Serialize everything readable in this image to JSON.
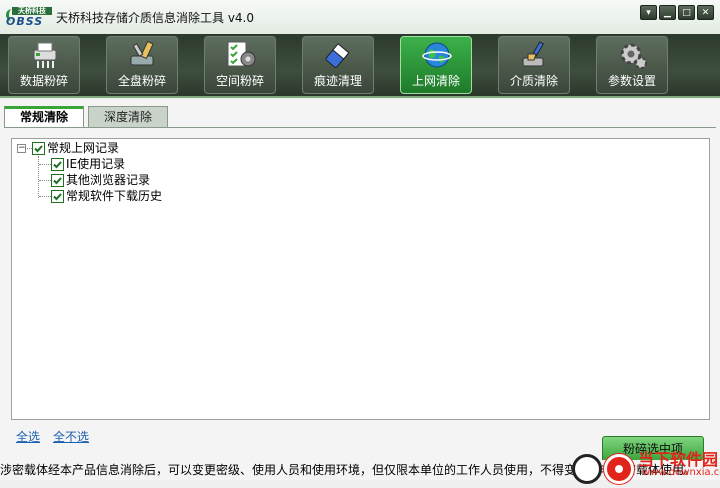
{
  "window": {
    "title": "天桥科技存储介质信息消除工具 v4.0",
    "logo_top": "天桥科技",
    "logo_bottom": "OBSS"
  },
  "toolbar": {
    "items": [
      {
        "label": "数据粉碎",
        "icon": "shredder-icon",
        "active": false
      },
      {
        "label": "全盘粉碎",
        "icon": "disk-shred-icon",
        "active": false
      },
      {
        "label": "空间粉碎",
        "icon": "space-shred-icon",
        "active": false
      },
      {
        "label": "痕迹清理",
        "icon": "eraser-icon",
        "active": false
      },
      {
        "label": "上网清除",
        "icon": "globe-icon",
        "active": true
      },
      {
        "label": "介质清除",
        "icon": "brush-icon",
        "active": false
      },
      {
        "label": "参数设置",
        "icon": "gear-icon",
        "active": false
      }
    ]
  },
  "tabs": [
    {
      "label": "常规清除",
      "active": true
    },
    {
      "label": "深度清除",
      "active": false
    }
  ],
  "tree": {
    "root": {
      "label": "常规上网记录",
      "checked": true,
      "expanded": true
    },
    "children": [
      {
        "label": "IE使用记录",
        "checked": true
      },
      {
        "label": "其他浏览器记录",
        "checked": true
      },
      {
        "label": "常规软件下载历史",
        "checked": true
      }
    ]
  },
  "actions": {
    "select_all": "全选",
    "select_none": "全不选",
    "shred_selected": "粉碎选中项"
  },
  "status_text": "涉密载体经本产品信息消除后，可以变更密级、使用人员和使用环境，但仅限本单位的工作人员使用，不得变更为非涉密载体使用。",
  "watermark": {
    "brand": "当下软件园",
    "url": "www.downxia.com"
  },
  "colors": {
    "accent": "#3aa33a",
    "toolbar_bg": "#2c3a2c",
    "link": "#1b5fb0"
  }
}
